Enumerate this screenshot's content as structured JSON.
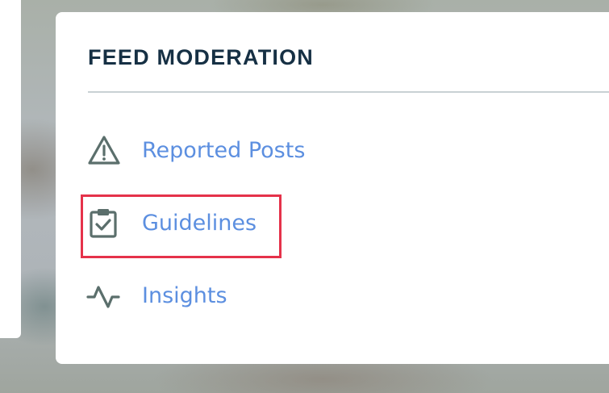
{
  "panel": {
    "title": "FEED MODERATION"
  },
  "nav": [
    {
      "label": "Reported Posts",
      "icon": "warning-triangle-icon"
    },
    {
      "label": "Guidelines",
      "icon": "clipboard-check-icon"
    },
    {
      "label": "Insights",
      "icon": "activity-icon"
    }
  ],
  "colors": {
    "title": "#163044",
    "link": "#5c8fe0",
    "icon": "#5b6f6c",
    "highlight": "#e5324a"
  }
}
